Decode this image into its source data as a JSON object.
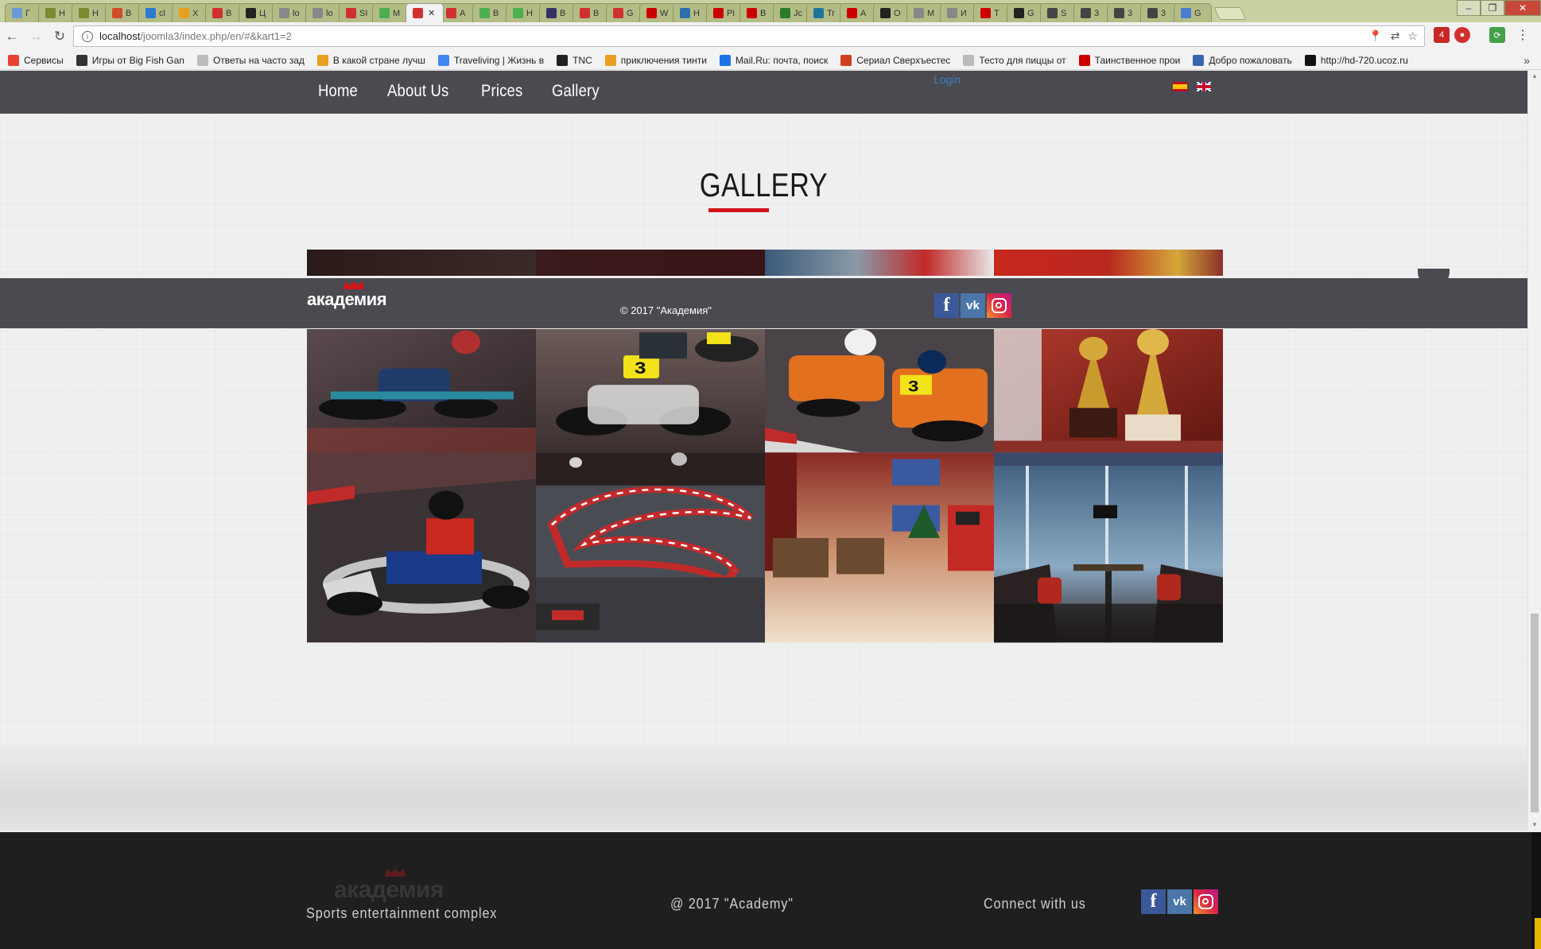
{
  "browser": {
    "tabs": [
      {
        "label": "Г",
        "color": "#6a9bd8"
      },
      {
        "label": "Н",
        "color": "#7a8a30"
      },
      {
        "label": "Н",
        "color": "#7a8a30"
      },
      {
        "label": "В",
        "color": "#d14b2a"
      },
      {
        "label": "cl",
        "color": "#2a7ad1"
      },
      {
        "label": "X",
        "color": "#e8a020"
      },
      {
        "label": "В",
        "color": "#d03030"
      },
      {
        "label": "Ц",
        "color": "#222222"
      },
      {
        "label": "lo",
        "color": "#888888"
      },
      {
        "label": "lo",
        "color": "#888888"
      },
      {
        "label": "SI",
        "color": "#d03030"
      },
      {
        "label": "M",
        "color": "#4caf50"
      },
      {
        "label": "",
        "color": "#d03030",
        "active": true
      },
      {
        "label": "A",
        "color": "#d03030"
      },
      {
        "label": "B",
        "color": "#4caf50"
      },
      {
        "label": "H",
        "color": "#4caf50"
      },
      {
        "label": "B",
        "color": "#333366"
      },
      {
        "label": "B",
        "color": "#d03030"
      },
      {
        "label": "G",
        "color": "#d03030"
      },
      {
        "label": "W",
        "color": "#cc0000"
      },
      {
        "label": "H",
        "color": "#2a6fa8"
      },
      {
        "label": "Pi",
        "color": "#cc0000"
      },
      {
        "label": "B",
        "color": "#cc0000"
      },
      {
        "label": "Jc",
        "color": "#2a7a2a"
      },
      {
        "label": "Tr",
        "color": "#21759b"
      },
      {
        "label": "A",
        "color": "#cc0000"
      },
      {
        "label": "O",
        "color": "#222222"
      },
      {
        "label": "M",
        "color": "#888888"
      },
      {
        "label": "И",
        "color": "#888888"
      },
      {
        "label": "T",
        "color": "#cc0000"
      },
      {
        "label": "G",
        "color": "#222222"
      },
      {
        "label": "S",
        "color": "#444444"
      },
      {
        "label": "3",
        "color": "#444444"
      },
      {
        "label": "3",
        "color": "#444444"
      },
      {
        "label": "3",
        "color": "#444444"
      },
      {
        "label": "G",
        "color": "#4a7ad1"
      }
    ],
    "url_host": "localhost",
    "url_path": "/joomla3/index.php/en/#&kart1=2",
    "bookmarks": [
      {
        "label": "Сервисы",
        "color": "#e94235"
      },
      {
        "label": "Игры от Big Fish Gan",
        "color": "#333333"
      },
      {
        "label": "Ответы на часто зад",
        "color": "#bbbbbb"
      },
      {
        "label": "В какой стране лучш",
        "color": "#e8a020"
      },
      {
        "label": "Traveliving | Жизнь в",
        "color": "#4285f4"
      },
      {
        "label": "TNC",
        "color": "#222222"
      },
      {
        "label": "приключения тинти",
        "color": "#e8a020"
      },
      {
        "label": "Mail.Ru: почта, поиск",
        "color": "#1a73e8"
      },
      {
        "label": "Сериал Сверхъестес",
        "color": "#d04020"
      },
      {
        "label": "Тесто для пиццы от",
        "color": "#bbbbbb"
      },
      {
        "label": "Таинственное прои",
        "color": "#cc0000"
      },
      {
        "label": "Добро пожаловать",
        "color": "#3a66b0"
      },
      {
        "label": "http://hd-720.ucoz.ru",
        "color": "#111111"
      }
    ]
  },
  "nav": {
    "items": [
      "Home",
      "About Us",
      "Prices",
      "Gallery"
    ],
    "login": "Login"
  },
  "gallery": {
    "title": "GALLERY"
  },
  "sticky_bar": {
    "logo_text": "академия",
    "copyright": "© 2017 \"Академия\""
  },
  "footer": {
    "logo_text": "академия",
    "tagline": "Sports entertainment complex",
    "copyright": "@ 2017 \"Academy\"",
    "connect": "Connect with us"
  },
  "social": {
    "fb": "f",
    "vk": "vk"
  },
  "colors": {
    "nav_bg": "#4a4a50",
    "accent_red": "#d4141b",
    "footer_bg": "#1f1f1f",
    "link_blue": "#3d7fc1"
  }
}
